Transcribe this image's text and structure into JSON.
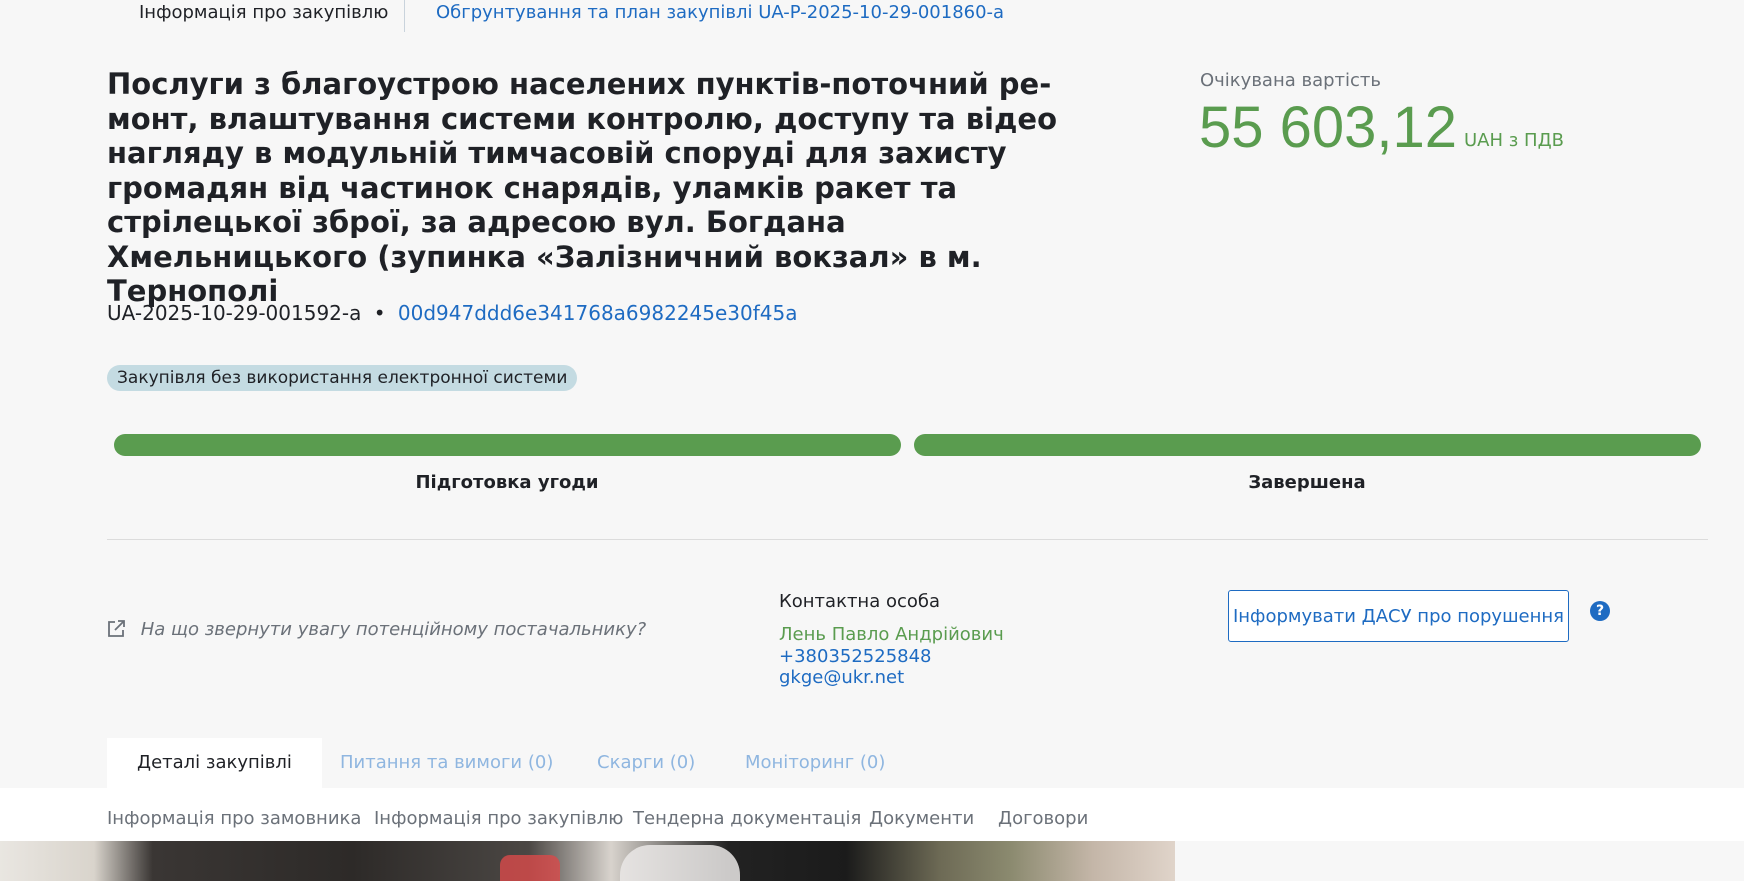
{
  "top_nav": {
    "active_tab": "Інформація про закупівлю",
    "plan_link": "Обгрунтування та план закупівлі UA-P-2025-10-29-001860-a"
  },
  "tender": {
    "title": "Послуги з благоустрою населених пунктів-поточний ре­монт, влаштування системи контролю, доступу та відео на­гляду в модульній тимчасовій споруді для захисту грома­дян від частинок снарядів, уламків ракет та стрілецької зброї, за адресою вул. Богдана Хмельницького (зупинка «Залізничний вокзал» в м. Тернополі",
    "id": "UA-2025-10-29-001592-a",
    "separator": "•",
    "hash": "00d947ddd6e341768a6982245e30f45a",
    "badge": "Закупівля без використання електронної системи"
  },
  "expected_value": {
    "label": "Очікувана вартість",
    "amount": "55 603,12",
    "currency": "UAH з ПДВ"
  },
  "progress": [
    {
      "label": "Підготовка угоди",
      "fraction": 1.0
    },
    {
      "label": "Завершена",
      "fraction": 1.0
    }
  ],
  "attention_link": "На що звернути увагу потенційному постачальнику?",
  "contact": {
    "label": "Контактна особа",
    "name": "Лень Павло Андрійович",
    "phone": "+380352525848",
    "email": "gkge@ukr.net"
  },
  "dasu_button": "Інформувати ДАСУ про порушення",
  "help_icon": "?",
  "main_tabs": [
    "Деталі закупівлі",
    "Питання та вимоги (0)",
    "Скарги (0)",
    "Моніторинг (0)"
  ],
  "sub_nav": [
    "Інформація про замовника",
    "Інформація про закупівлю",
    "Тендерна документація",
    "Документи",
    "Договори"
  ],
  "colors": {
    "accent_green": "#5a9c4f",
    "link_blue": "#1e6bc2",
    "badge_bg": "#c4dbe2"
  }
}
